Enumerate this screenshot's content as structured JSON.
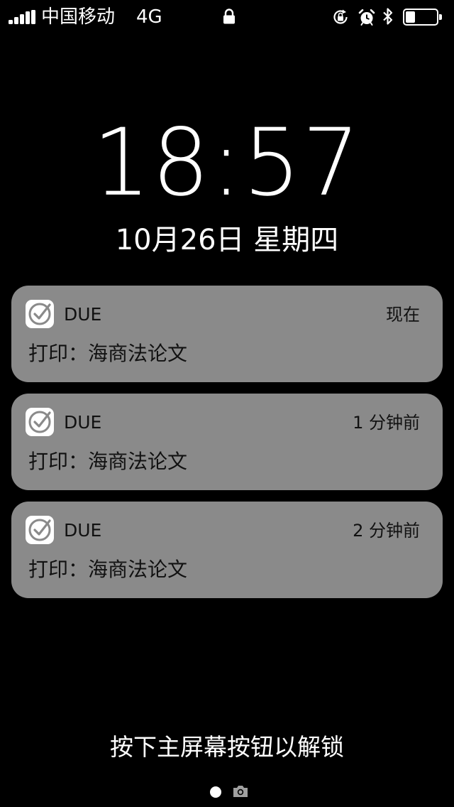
{
  "status_bar": {
    "carrier": "中国移动",
    "network": "4G",
    "signal_bars": 5,
    "battery_level": 0.3,
    "icons": [
      "lock-icon",
      "rotation-lock-icon",
      "alarm-icon",
      "bluetooth-icon",
      "battery-icon"
    ]
  },
  "lock_screen": {
    "time": "18:57",
    "date": "10月26日 星期四",
    "unlock_hint": "按下主屏幕按钮以解锁"
  },
  "notifications": [
    {
      "app": "DUE",
      "time": "现在",
      "body": "打印：海商法论文",
      "icon": "due-checkmark-icon"
    },
    {
      "app": "DUE",
      "time": "1 分钟前",
      "body": "打印：海商法论文",
      "icon": "due-checkmark-icon"
    },
    {
      "app": "DUE",
      "time": "2 分钟前",
      "body": "打印：海商法论文",
      "icon": "due-checkmark-icon"
    }
  ],
  "colors": {
    "background": "#000000",
    "card": "#8a8a8a",
    "text": "#ffffff",
    "card_text": "#111111"
  },
  "page_indicator": {
    "current_page": 1,
    "trailing_icon": "camera-icon"
  }
}
